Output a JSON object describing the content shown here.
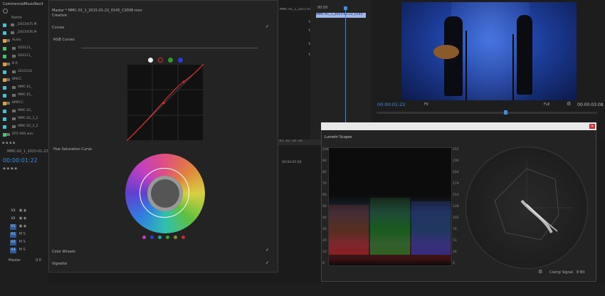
{
  "project": {
    "title": "CommercialMusicRecit",
    "name_header": "Name",
    "items": [
      {
        "label": "_DSC0475.M",
        "color": "#4ac0d0"
      },
      {
        "label": "_DSC0476.M",
        "color": "#4ac0d0"
      },
      {
        "label": "Audio",
        "color": "#e0a040"
      },
      {
        "label": "SDS121_",
        "color": "#4ac070"
      },
      {
        "label": "SDS121_",
        "color": "#4ac070"
      },
      {
        "label": "B-R",
        "color": "#e0a040"
      },
      {
        "label": "2015110",
        "color": "#4ac0d0"
      },
      {
        "label": "BMCC",
        "color": "#e0a040"
      },
      {
        "label": "MMC-01_",
        "color": "#4ac0d0"
      },
      {
        "label": "MMC-01_",
        "color": "#4ac0d0"
      },
      {
        "label": "BMPCC",
        "color": "#e0a040"
      },
      {
        "label": "MMC-02_",
        "color": "#4ac0d0"
      },
      {
        "label": "MMC-02_1_2",
        "color": "#4ac0d0"
      },
      {
        "label": "MMC-02_1_2",
        "color": "#4ac0d0"
      },
      {
        "label": "DTE-900.wav",
        "color": "#4ac070"
      }
    ]
  },
  "timeline": {
    "sequence_tab": "MMC-02_1_2015-01-22",
    "timecode": "00:00:01:22",
    "tracks": [
      "V3",
      "V2",
      "V1",
      "A1",
      "A2",
      "A3"
    ],
    "master_label": "Master",
    "master_value": "0.0",
    "ruler_time": "00:00:05:00"
  },
  "lumetri": {
    "breadcrumb": "Master * MMC-01_1_2015-01-22_0145_C0008.mov",
    "sequence_breadcrumb": "MMC-01_1_2015-01-22_0145_C0008 * MMC-01_1_2015-01-22_0145_C0008.mov",
    "creative": "Creative",
    "curves": "Curves",
    "rgb_curves": "RGB Curves",
    "hue_sat": "Hue Saturation Curve",
    "color_wheels": "Color Wheels",
    "vignette": "Vignette"
  },
  "source": {
    "time": "00:00",
    "clip": "MMC-01_1_2015-01-22_0145"
  },
  "program": {
    "timecode": "00:00:01:22",
    "fit": "Fit",
    "quality": "Full",
    "duration": "00:00:03:08"
  },
  "scopes": {
    "title": "Lumetri Scopes",
    "left_scale": [
      "100",
      "90",
      "80",
      "70",
      "60",
      "50",
      "40",
      "30",
      "20",
      "10",
      "0"
    ],
    "right_scale": [
      "255",
      "230",
      "204",
      "179",
      "153",
      "128",
      "102",
      "76",
      "51",
      "26",
      "0"
    ],
    "clamp": "Clamp Signal",
    "bit": "8 Bit"
  },
  "colors": {
    "accent": "#3a8ee6",
    "curve": "#e03030"
  }
}
